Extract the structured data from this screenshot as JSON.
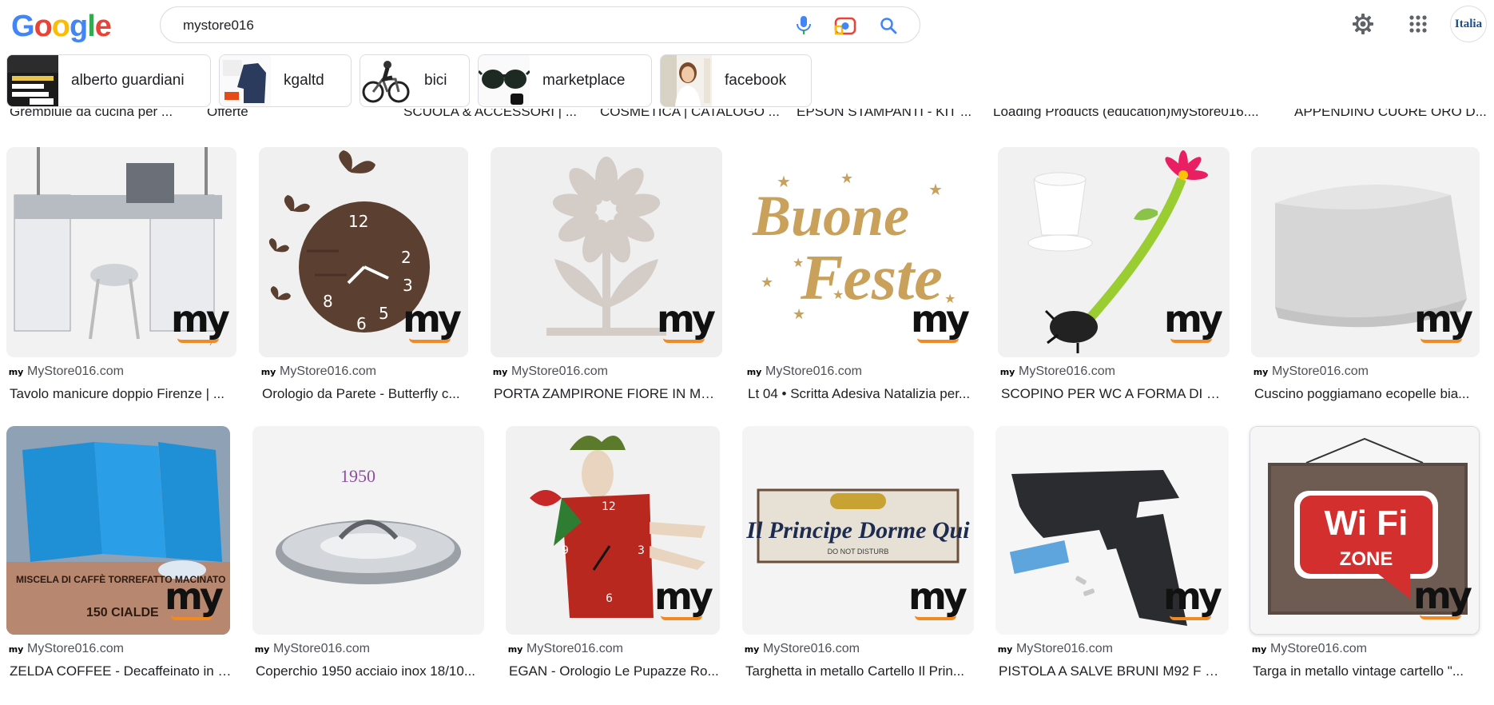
{
  "search": {
    "query": "mystore016"
  },
  "logo": {
    "letters": [
      "G",
      "o",
      "o",
      "g",
      "l",
      "e"
    ],
    "colors": [
      "#4285F4",
      "#EA4335",
      "#FBBC05",
      "#4285F4",
      "#34A853",
      "#EA4335"
    ]
  },
  "avatar": {
    "text": "Italia"
  },
  "chips": [
    {
      "label": "alberto guardiani"
    },
    {
      "label": "kgaltd"
    },
    {
      "label": "bici"
    },
    {
      "label": "marketplace"
    },
    {
      "label": "facebook"
    }
  ],
  "partial_row": [
    "Grembiule da cucina per ...",
    "Offerte",
    "SCUOLA & ACCESSORI | ...",
    "COSMETICA | CATALOGO ...",
    "EPSON STAMPANTI - KIT ...",
    "Loading Products (education)MyStore016....",
    "APPENDINO CUORE ORO D..."
  ],
  "results": [
    {
      "source": "MyStore016.com",
      "title": "Tavolo manicure doppio Firenze | ...",
      "image": "manicure-table"
    },
    {
      "source": "MyStore016.com",
      "title": "Orologio da Parete - Butterfly c...",
      "image": "butterfly-clock"
    },
    {
      "source": "MyStore016.com",
      "title": "PORTA ZAMPIRONE FIORE IN MET...",
      "image": "flower-holder"
    },
    {
      "source": "MyStore016.com",
      "title": "Lt 04 • Scritta Adesiva Natalizia per...",
      "image": "buone-feste",
      "art_text": [
        "Buone",
        "Feste"
      ]
    },
    {
      "source": "MyStore016.com",
      "title": "SCOPINO PER WC A FORMA DI FIO...",
      "image": "toilet-brush"
    },
    {
      "source": "MyStore016.com",
      "title": "Cuscino poggiamano ecopelle bia...",
      "image": "cushion"
    },
    {
      "source": "MyStore016.com",
      "title": "ZELDA COFFEE - Decaffeinato in c...",
      "image": "coffee",
      "art_text": [
        "MISCELA DI CAFFÈ TORREFATTO MACINATO",
        "150 CIALDE"
      ]
    },
    {
      "source": "MyStore016.com",
      "title": "Coperchio 1950 acciaio inox 18/10...",
      "image": "lid",
      "art_text": [
        "1950"
      ]
    },
    {
      "source": "MyStore016.com",
      "title": "EGAN - Orologio Le Pupazze Ro...",
      "image": "doll-clock"
    },
    {
      "source": "MyStore016.com",
      "title": "Targhetta in metallo Cartello Il Prin...",
      "image": "sign",
      "art_text": [
        "Il Principe Dorme Qui",
        "DO NOT DISTURB"
      ]
    },
    {
      "source": "MyStore016.com",
      "title": "PISTOLA A SALVE BRUNI M92 F CA...",
      "image": "pistol"
    },
    {
      "source": "MyStore016.com",
      "title": "Targa in metallo vintage cartello \"...",
      "image": "wifi-sign",
      "art_text": [
        "Wi Fi",
        "ZONE"
      ]
    }
  ],
  "colors": {
    "brand_orange": "#f28a24",
    "mic_blue": "#4285F4",
    "watermark": "#111111"
  }
}
